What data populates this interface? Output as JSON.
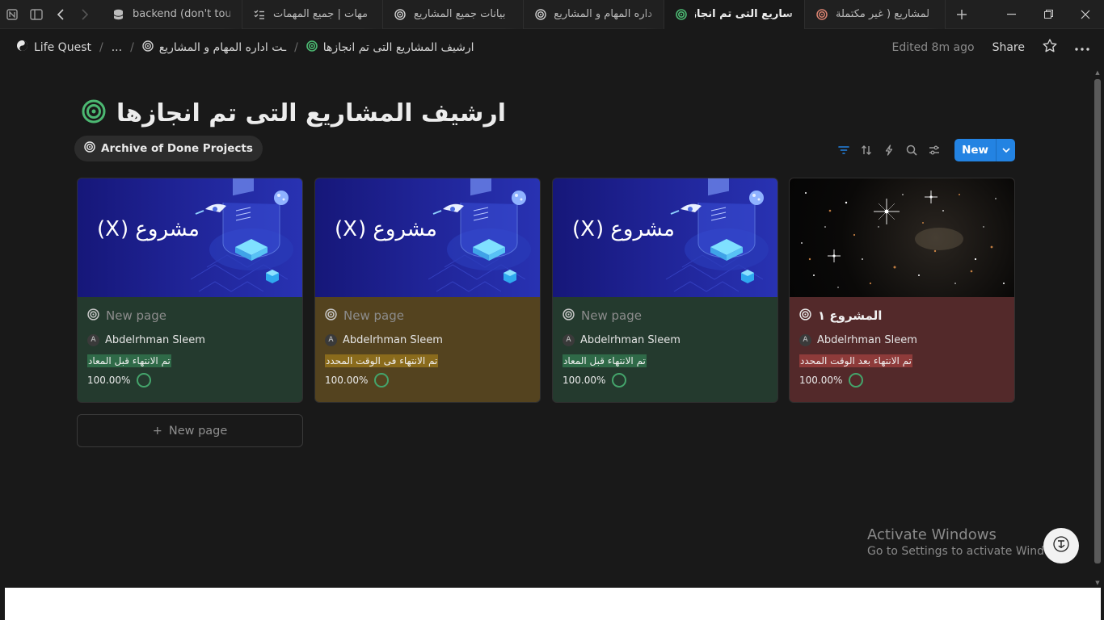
{
  "tabs": [
    {
      "label": "backend (don't touc",
      "icon": "database-icon",
      "active": false
    },
    {
      "label": "مهات | جميع المهمات",
      "icon": "checklist-icon",
      "active": false
    },
    {
      "label": "بيانات جميع المشاريع",
      "icon": "target-icon",
      "active": false
    },
    {
      "label": "داره المهام و المشاريع",
      "icon": "target-icon",
      "active": false
    },
    {
      "label": "ساريع التى تم انجازها",
      "icon": "target-icon",
      "active": true
    },
    {
      "label": "لمشاريع ( غير مكتملة",
      "icon": "target-icon",
      "active": false
    }
  ],
  "breadcrumb": {
    "workspace": "Life Quest",
    "ellipsis": "...",
    "parent": "ـت اداره المهام و المشاريع",
    "current": "ارشيف المشاريع التى تم انجازها",
    "edited": "Edited 8m ago",
    "share": "Share"
  },
  "page": {
    "title": "ارشيف المشاريع التى تم انجازها",
    "view_tab": "Archive of Done Projects",
    "new_button": "New"
  },
  "cards": [
    {
      "cover_text": "مشروع (X)",
      "title": "New page",
      "person": "Abdelrhman Sleem",
      "avatar": "A",
      "status": "تم الانتهاء قبل المعاد",
      "progress": "100.00%"
    },
    {
      "cover_text": "مشروع (X)",
      "title": "New page",
      "person": "Abdelrhman Sleem",
      "avatar": "A",
      "status": "تم الانتهاء فى الوقت المحدد",
      "progress": "100.00%"
    },
    {
      "cover_text": "مشروع (X)",
      "title": "New page",
      "person": "Abdelrhman Sleem",
      "avatar": "A",
      "status": "تم الانتهاء قبل المعاد",
      "progress": "100.00%"
    },
    {
      "cover_text": "",
      "title": "المشروع ١",
      "person": "Abdelrhman Sleem",
      "avatar": "A",
      "status": "تم الانتهاء بعد الوقت المحدد",
      "progress": "100.00%"
    }
  ],
  "new_page_row": "New page",
  "new_page_plus": "+",
  "watermark": {
    "line1": "Activate Windows",
    "line2": "Go to Settings to activate Windows."
  },
  "colors": {
    "accent": "#2383e2",
    "green_card": "#243a2e",
    "yellow_card": "#54431f",
    "red_card": "#53292a",
    "ring": "#44a46b"
  }
}
